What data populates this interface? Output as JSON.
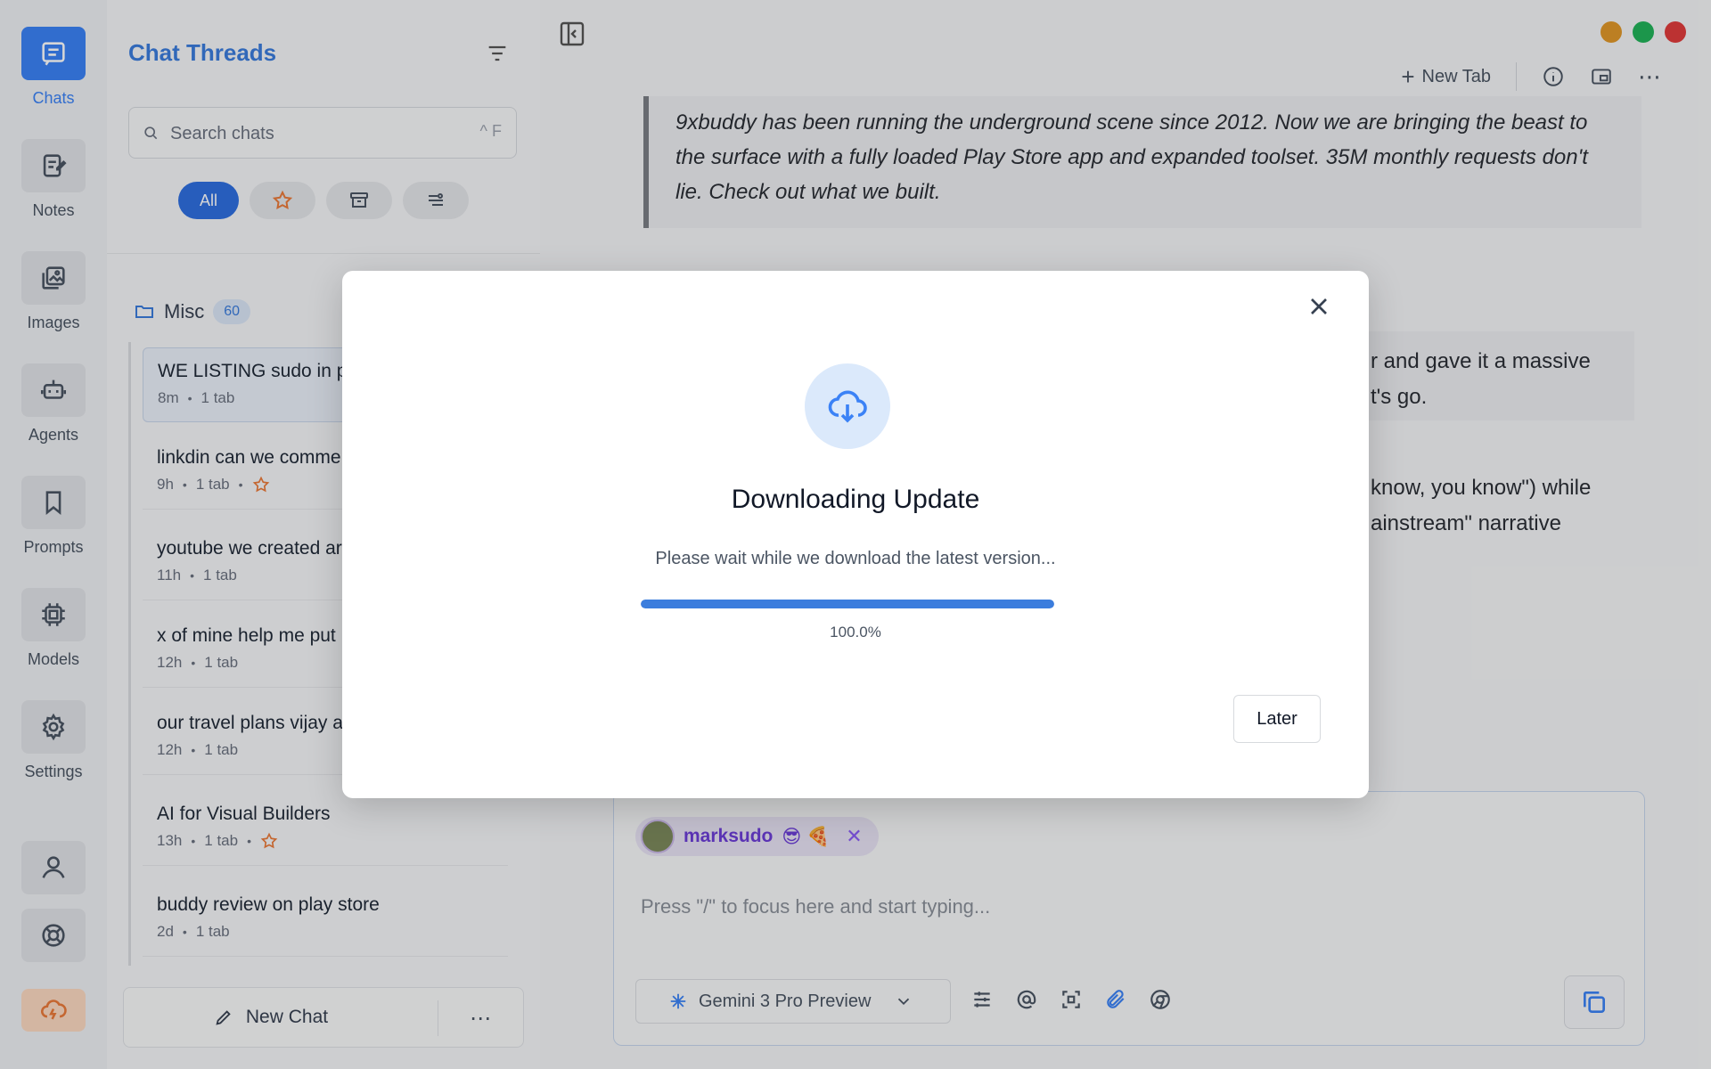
{
  "rail": {
    "items": [
      {
        "label": "Chats",
        "icon": "chat-icon",
        "active": true
      },
      {
        "label": "Notes",
        "icon": "notes-icon"
      },
      {
        "label": "Images",
        "icon": "images-icon"
      },
      {
        "label": "Agents",
        "icon": "robot-icon"
      },
      {
        "label": "Prompts",
        "icon": "bookmark-icon"
      },
      {
        "label": "Models",
        "icon": "cpu-icon"
      },
      {
        "label": "Settings",
        "icon": "gear-icon"
      }
    ]
  },
  "sidebar": {
    "title": "Chat Threads",
    "search": {
      "placeholder": "Search chats",
      "shortcut": "^ F"
    },
    "filters": {
      "all_label": "All"
    },
    "folder": {
      "name": "Misc",
      "count": "60"
    },
    "threads": [
      {
        "title": "WE LISTING sudo in pe",
        "time": "8m",
        "tabs": "1 tab",
        "starred": false,
        "selected": true
      },
      {
        "title": "linkdin can we comme",
        "time": "9h",
        "tabs": "1 tab",
        "starred": true
      },
      {
        "title": "youtube we created ar",
        "time": "11h",
        "tabs": "1 tab",
        "starred": false
      },
      {
        "title": "x of mine help me put",
        "time": "12h",
        "tabs": "1 tab",
        "starred": false
      },
      {
        "title": "our travel plans vijay a",
        "time": "12h",
        "tabs": "1 tab",
        "starred": false
      },
      {
        "title": "AI for Visual Builders",
        "time": "13h",
        "tabs": "1 tab",
        "starred": true
      },
      {
        "title": "buddy review on play store",
        "time": "2d",
        "tabs": "1 tab",
        "starred": false
      }
    ],
    "new_chat_label": "New Chat"
  },
  "main": {
    "topbar": {
      "new_tab_label": "New Tab"
    },
    "window_colors": {
      "minimize": "#e0982a",
      "maximize": "#22b35a",
      "close": "#e03c3c"
    },
    "quote": "9xbuddy has been running the underground scene since 2012. Now we are bringing the beast to the surface with a fully loaded Play Store app and expanded toolset. 35M monthly requests don't lie. Check out what we built.",
    "behind_texts": [
      "r and gave it a massive",
      "t's go.",
      "know, you know\") while",
      "ainstream\" narrative"
    ],
    "composer": {
      "mention_name": "marksudo",
      "mention_emoji": "😎 🍕",
      "placeholder": "Press \"/\" to focus here and start typing...",
      "model": "Gemini 3 Pro Preview"
    }
  },
  "modal": {
    "title": "Downloading Update",
    "description": "Please wait while we download the latest version...",
    "progress": 1.0,
    "progress_label": "100.0%",
    "later_label": "Later",
    "accent": "#3b7ddd"
  }
}
